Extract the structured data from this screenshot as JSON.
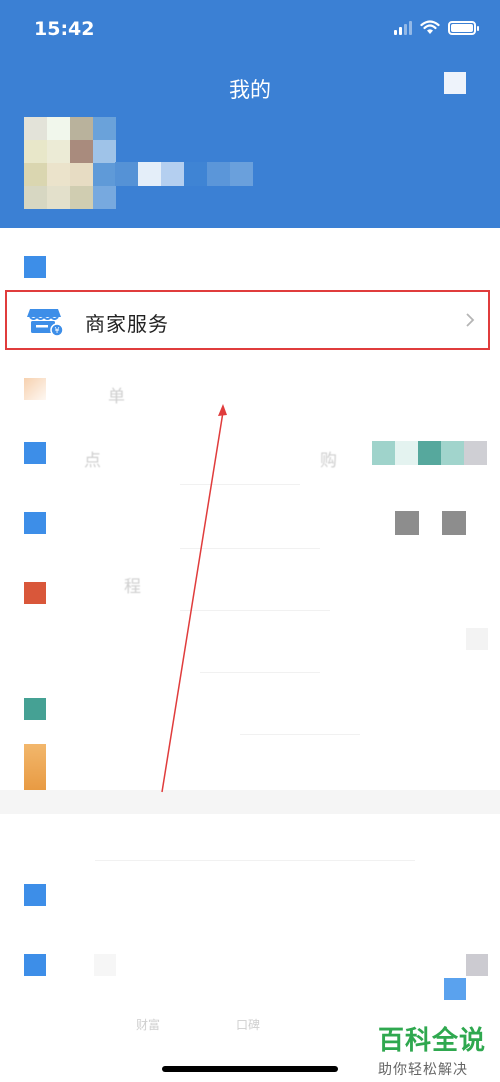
{
  "status_bar": {
    "time": "15:42"
  },
  "header": {
    "title": "我的"
  },
  "menu": {
    "merchant_services": {
      "label": "商家服务"
    },
    "faint_labels": [
      "单",
      "点",
      "购",
      "程"
    ]
  },
  "watermark": {
    "title": "百科全说",
    "subtitle": "助你轻松解决"
  },
  "bottom_tabs": [
    "财富",
    "口碑"
  ],
  "colors": {
    "header_blue": "#3b80d4",
    "highlight_red": "#e03c3c",
    "icon_blue": "#3d8ee8",
    "icon_red": "#d9573a",
    "icon_teal": "#45a194",
    "icon_orange": "#eaa24f",
    "watermark_green": "#2fa84f"
  },
  "icons": [
    "signal-icon",
    "wifi-icon",
    "battery-icon",
    "store-icon",
    "chevron-right-icon"
  ]
}
